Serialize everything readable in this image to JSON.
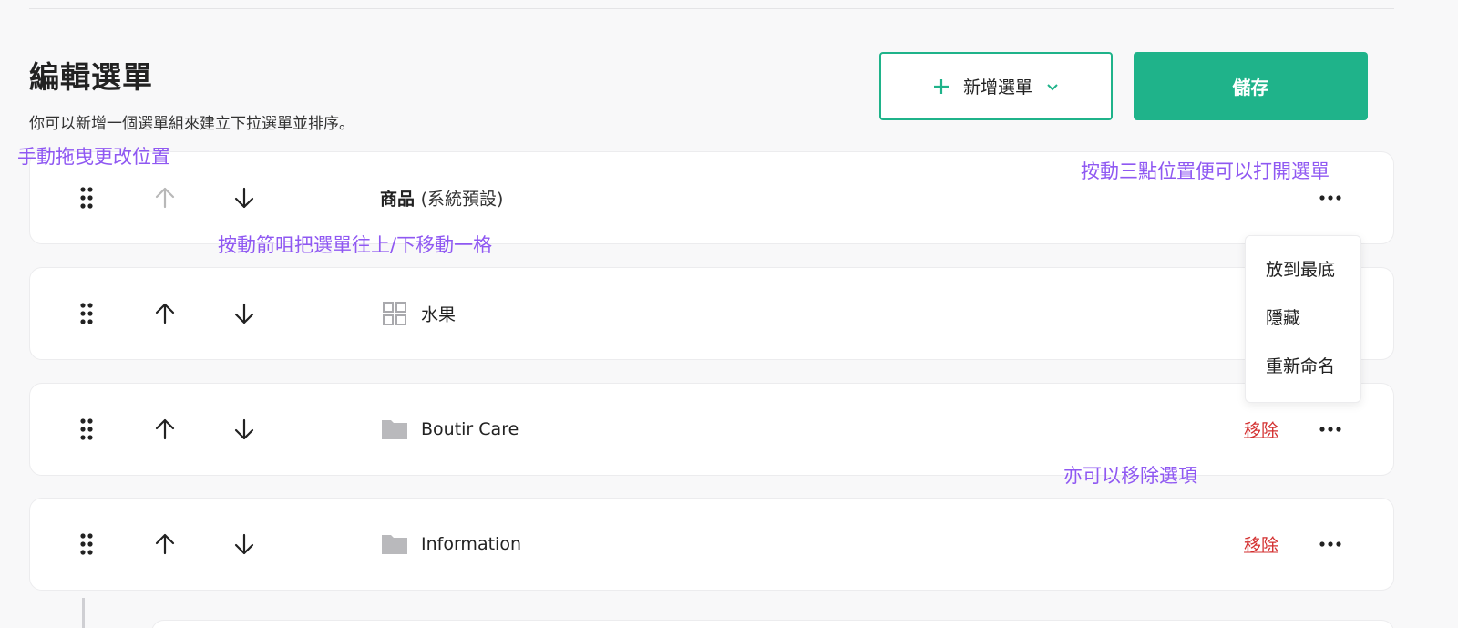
{
  "header": {
    "title": "編輯選單",
    "subtitle": "你可以新增一個選單組來建立下拉選單並排序。",
    "add_menu_label": "新增選單",
    "save_label": "儲存"
  },
  "annotations": {
    "drag": "手動拖曳更改位置",
    "dots": "按動三點位置便可以打開選單",
    "arrows": "按動箭咀把選單往上/下移動一格",
    "remove": "亦可以移除選項"
  },
  "rows": [
    {
      "label": "商品",
      "sub": "(系統預設)",
      "icon": "none",
      "up_enabled": false,
      "remove": ""
    },
    {
      "label": "水果",
      "icon": "grid-icon",
      "up_enabled": true,
      "remove": ""
    },
    {
      "label": "Boutir Care",
      "icon": "folder-icon",
      "up_enabled": true,
      "remove": "移除"
    },
    {
      "label": "Information",
      "icon": "folder-icon",
      "up_enabled": true,
      "remove": "移除"
    }
  ],
  "dropdown": {
    "items": [
      "放到最底",
      "隱藏",
      "重新命名"
    ]
  },
  "colors": {
    "accent": "#1fb38a",
    "annotation": "#8f58f2",
    "remove": "#d32f2f",
    "disabled_arrow": "#b8b8b8"
  }
}
